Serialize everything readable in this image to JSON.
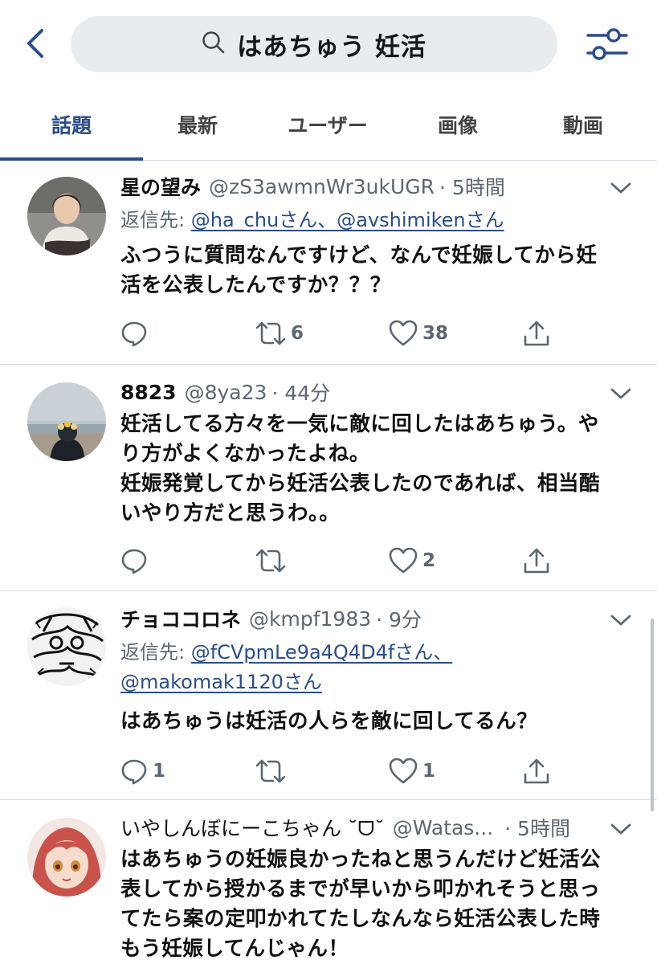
{
  "search": {
    "query": "はあちゅう 妊活"
  },
  "tabs": [
    {
      "label": "話題",
      "active": true
    },
    {
      "label": "最新",
      "active": false
    },
    {
      "label": "ユーザー",
      "active": false
    },
    {
      "label": "画像",
      "active": false
    },
    {
      "label": "動画",
      "active": false
    }
  ],
  "colors": {
    "accent": "#2b4d8c",
    "muted": "#5b6670",
    "search_bg": "#e9ecef",
    "divider": "#d6dbe0"
  },
  "tweets": [
    {
      "name": "星の望み",
      "handle": "@zS3awmnWr3ukUGR",
      "time": "· 5時間",
      "reply_prefix": "返信先:",
      "reply_to_1": "@ha_chuさん、@avshimikenさん",
      "reply_to_2": "",
      "text": "ふつうに質問なんですけど、なんで妊娠してから妊\n活を公表したんですか？？？",
      "replies": "",
      "retweets": "6",
      "likes": "38"
    },
    {
      "name": "8823",
      "handle": "@8ya23",
      "time": "· 44分",
      "text": "妊活してる方々を一気に敵に回したはあちゅう。や\nり方がよくなかったよね。\n妊娠発覚してから妊活公表したのであれば、相当酷\nいやり方だと思うわ。。",
      "replies": "",
      "retweets": "",
      "likes": "2"
    },
    {
      "name": "チョココロネ",
      "handle": "@kmpf1983",
      "time": "· 9分",
      "reply_prefix": "返信先:",
      "reply_to_1": "@fCVpmLe9a4Q4D4fさん、",
      "reply_to_2": "@makomak1120さん",
      "text": "はあちゅうは妊活の人らを敵に回してるん？",
      "replies": "1",
      "retweets": "",
      "likes": "1"
    },
    {
      "name": "いやしんぼにーこちゃん ˘ᗜ˘",
      "handle": "@Watas...",
      "time": "· 5時間",
      "text": "はあちゅうの妊娠良かったねと思うんだけど妊活公\n表してから授かるまでが早いから叩かれそうと思っ\nてたら案の定叩かれてたしなんなら妊活公表した時\nもう妊娠してんじゃん！"
    }
  ]
}
